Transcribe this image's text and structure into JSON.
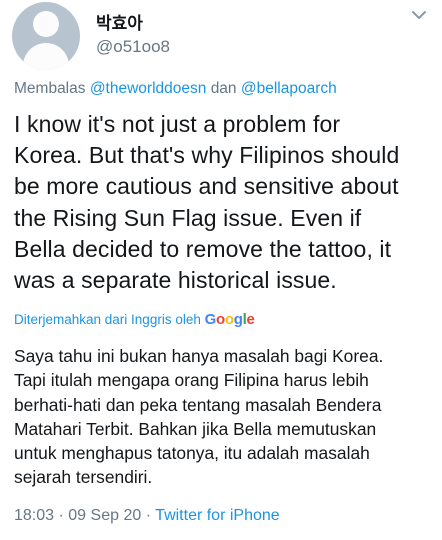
{
  "user": {
    "display_name": "박효아",
    "handle": "@o51oo8",
    "avatar_icon": "default-profile-icon"
  },
  "reply": {
    "prefix": "Membalas",
    "mention_1": "@theworlddoesn",
    "joiner": "dan",
    "mention_2": "@bellapoarch"
  },
  "tweet": {
    "lines": [
      "I know it's not just a problem for",
      "Korea. But that's why Filipinos should",
      "be more cautious and sensitive about",
      "the Rising Sun Flag issue. Even if",
      "Bella decided to remove the tattoo, it",
      "was a separate historical issue."
    ]
  },
  "translation": {
    "label": "Diterjemahkan dari Inggris oleh",
    "provider": "Google",
    "lines": [
      "Saya tahu ini bukan hanya masalah bagi Korea.",
      "Tapi itulah mengapa orang Filipina harus lebih",
      "berhati-hati dan peka tentang masalah Bendera",
      "Matahari Terbit. Bahkan jika Bella memutuskan",
      "untuk menghapus tatonya, itu adalah masalah",
      "sejarah tersendiri."
    ]
  },
  "meta": {
    "time": "18:03",
    "date": "09 Sep 20",
    "separator": "·",
    "source": "Twitter for iPhone"
  },
  "colors": {
    "link": "#1b95e0",
    "secondary": "#657786",
    "text": "#14171a"
  }
}
